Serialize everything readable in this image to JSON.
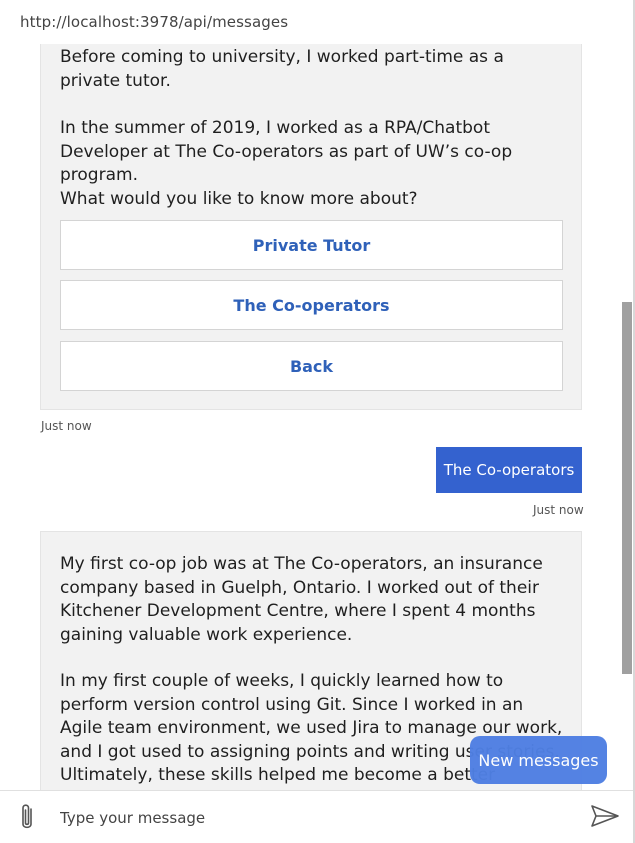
{
  "browser": {
    "url": "http://localhost:3978/api/messages"
  },
  "transcript": {
    "bot_card_1": {
      "paragraph_1": "Before coming to university, I worked part-time as a private tutor.",
      "paragraph_2": "In the summer of 2019, I worked as a RPA/Chatbot Developer at The Co-operators as part of UW’s co-op program.",
      "prompt": "What would you like to know more about?",
      "buttons": [
        "Private Tutor",
        "The Co-operators",
        "Back"
      ],
      "timestamp": "Just now"
    },
    "user_message": {
      "text": "The Co-operators",
      "timestamp": "Just now"
    },
    "bot_card_2": {
      "paragraph_1": "My first co-op job was at The Co-operators, an insurance company based in Guelph, Ontario. I worked out of their Kitchener Development Centre, where I spent 4 months gaining valuable work experience.",
      "paragraph_2": "In my first couple of weeks, I quickly learned how to perform version control using Git. Since I worked in an Agile team environment, we used Jira to manage our work, and I got used to assigning points and writing user stories. Ultimately, these skills helped me become a better developer."
    }
  },
  "new_messages_label": "New messages",
  "input": {
    "placeholder": "Type your message",
    "value": ""
  },
  "icons": {
    "attach": "paperclip-icon",
    "send": "send-icon"
  },
  "colors": {
    "accent": "#3462cf",
    "button_text": "#2f61b9",
    "card_bg": "#f2f2f2"
  }
}
